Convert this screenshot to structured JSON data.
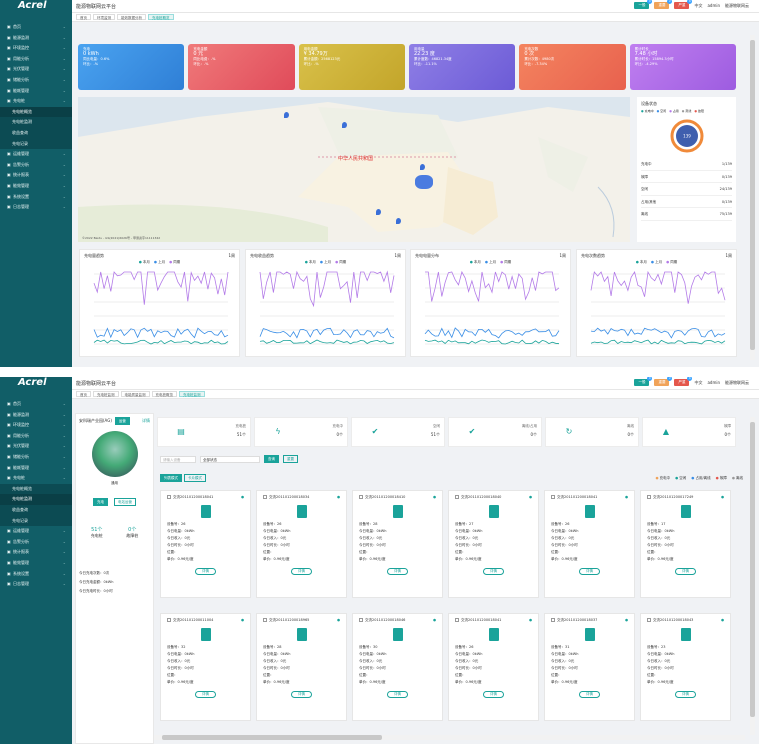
{
  "sidebar": {
    "logo": "Acrel",
    "items": [
      "首页",
      "能源监测",
      "环境监控",
      "用能分析",
      "光伏管理",
      "储能分析",
      "能耗管理",
      "充电桩",
      "运维管理",
      "告警分析",
      "统计报表",
      "能效管理",
      "系统设置",
      "日志管理"
    ],
    "sub1": [
      "充电桩概览",
      "充电桩监测",
      "收益查询",
      "充电记录"
    ]
  },
  "header": {
    "title": "能源物联网云平台",
    "btn_a": "一般",
    "btn_b": "重要",
    "btn_c": "严重",
    "count_a": "0",
    "count_b": "2",
    "count_c": "6",
    "lang": "中文",
    "user": "admin",
    "proj": "能源物联网云"
  },
  "s1": {
    "tabs": [
      "首页",
      "环境监测",
      "能效数据分析",
      "充电桩概览"
    ],
    "cards": [
      {
        "t": "充电",
        "v": "0 kWh",
        "a": "同比电量：0.6%",
        "b": "环比：-%"
      },
      {
        "t": "充电金额",
        "v": "0 元",
        "a": "同比电费：-%",
        "b": "环比：-%"
      },
      {
        "t": "用电金额",
        "v": "¥ 34.79万",
        "a": "累计金额：2568123元",
        "b": "环比：-%"
      },
      {
        "t": "用电量",
        "v": "22.23 度",
        "a": "累计度数：46821.34度",
        "b": "环比：-11.1%"
      },
      {
        "t": "充电次数",
        "v": "0 次",
        "a": "累计次数：4980次",
        "b": "环比：-7.34%"
      },
      {
        "t": "累计时长",
        "v": "7.48 小时",
        "a": "累计时长：15894.3小时",
        "b": "环比：-4.29%"
      }
    ],
    "map_label": "中华人民共和国",
    "map_footer": "©2022 Baidu - GS(2021)6026号 - 甲测资字11111342",
    "legend": [
      "充电中",
      "空闲",
      "占用",
      "离线",
      "故障"
    ],
    "stats_title": "设备状态",
    "donut": "139",
    "rows": [
      {
        "k": "充电中",
        "v": "1/139"
      },
      {
        "k": "故障",
        "v": "0/139"
      },
      {
        "k": "空闲",
        "v": "24/139"
      },
      {
        "k": "占用/其他",
        "v": "0/139"
      },
      {
        "k": "离线",
        "v": "75/139"
      }
    ],
    "charts": [
      {
        "t": "充电量趋势",
        "u": "1周"
      },
      {
        "t": "充电收益趋势",
        "u": "1周"
      },
      {
        "t": "充电电量分布",
        "u": "1周"
      },
      {
        "t": "充电次数趋势",
        "u": "1周"
      }
    ],
    "chart_legend": [
      "本月",
      "上月",
      "同期"
    ]
  },
  "s2": {
    "tabs": [
      "首页",
      "充电桩监测",
      "电能质量监测",
      "充电桩概览",
      "充电桩监测"
    ],
    "site": "安科瑞产业园(AG)",
    "site_tag": "运营",
    "more": "详情",
    "site_desc": "通用",
    "btn_a": "充电",
    "btn_b": "电站运营",
    "n1": "51个",
    "n1l": "充电桩",
    "n2": "0个",
    "n2l": "故障桩",
    "info": [
      "今日充电次数：0次",
      "今日充电金额：0kWh",
      "今日充电时长：0小时"
    ],
    "stats": [
      {
        "k": "充电桩",
        "v": "51个"
      },
      {
        "k": "充电中",
        "v": "0个"
      },
      {
        "k": "空闲",
        "v": "51个"
      },
      {
        "k": "离线/占用",
        "v": "0个"
      },
      {
        "k": "离线",
        "v": "0个"
      },
      {
        "k": "故障",
        "v": "0个"
      }
    ],
    "search_ph": "请输入设备",
    "select": "全部状态",
    "query": "查询",
    "reset": "重置",
    "view_a": "列表模式",
    "view_b": "卡片模式",
    "legend": [
      "充电中",
      "空闲",
      "占用/离线",
      "故障",
      "离线"
    ],
    "cards": [
      {
        "id": "交流201101200018041",
        "no": "26"
      },
      {
        "id": "交流201101200018034",
        "no": "26"
      },
      {
        "id": "交流201101200018410",
        "no": "28"
      },
      {
        "id": "交流201101200018040",
        "no": "27"
      },
      {
        "id": "交流201101200018041",
        "no": "26"
      },
      {
        "id": "交流201101200017249",
        "no": "17"
      },
      {
        "id": "交流201101200011004",
        "no": "32"
      },
      {
        "id": "交流201101200018965",
        "no": "28"
      },
      {
        "id": "交流201101200018046",
        "no": "30"
      },
      {
        "id": "交流201101200018041",
        "no": "26"
      },
      {
        "id": "交流201101200018037",
        "no": "31"
      },
      {
        "id": "交流201101200018043",
        "no": "23"
      }
    ],
    "card_l1": "今日电量：0kWh",
    "card_l2": "今日收入：0元",
    "card_l3": "今日时长：0小时",
    "card_l4": "位置：",
    "card_l5": "单价：0.96元/度",
    "card_btn": "详情",
    "card_l0": "设备号："
  }
}
